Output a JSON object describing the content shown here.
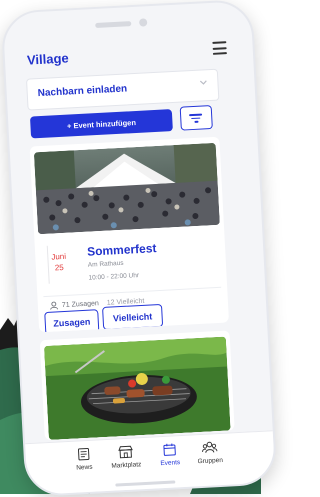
{
  "app": {
    "title": "Village"
  },
  "neighbors_select": {
    "label": "Nachbarn einladen"
  },
  "toolbar": {
    "add_event_label": "+ Event hinzufügen"
  },
  "event": {
    "month": "Juni",
    "day": "25",
    "title": "Sommerfest",
    "location": "Am Rathaus",
    "time": "10:00 - 22:00 Uhr",
    "accepted": "71 Zusagen",
    "maybe": "12 Vielleicht",
    "accept_label": "Zusagen",
    "maybe_label": "Vielleicht"
  },
  "tabs": [
    {
      "label": "News",
      "icon": "news-icon"
    },
    {
      "label": "Marktplatz",
      "icon": "store-icon"
    },
    {
      "label": "Events",
      "icon": "calendar-icon"
    },
    {
      "label": "Gruppen",
      "icon": "group-icon"
    }
  ],
  "colors": {
    "primary": "#2436d8",
    "accent_red": "#e23b3b"
  }
}
